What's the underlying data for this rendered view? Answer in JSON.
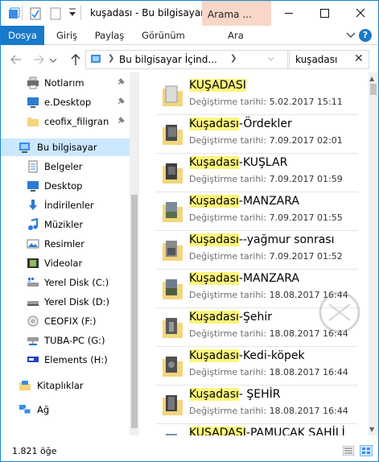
{
  "window": {
    "title": "kuşadası - Bu bilgisayar İ...",
    "context_tab": "Arama ..."
  },
  "ribbon": {
    "tabs": [
      "Dosya",
      "Giriş",
      "Paylaş",
      "Görünüm",
      "Ara"
    ]
  },
  "address": {
    "crumb": "Bu bilgisayar İçind...",
    "search_value": "kuşadası"
  },
  "nav": {
    "items": [
      {
        "label": "Notlarım",
        "icon": "printer-icon",
        "pinned": true
      },
      {
        "label": "e.Desktop",
        "icon": "desktop-icon",
        "pinned": true
      },
      {
        "label": "ceofix_filigran",
        "icon": "folder-icon",
        "pinned": true
      },
      {
        "label": "Bu bilgisayar",
        "icon": "computer-icon",
        "selected": true
      },
      {
        "label": "Belgeler",
        "icon": "documents-icon"
      },
      {
        "label": "Desktop",
        "icon": "desktop-icon"
      },
      {
        "label": "İndirilenler",
        "icon": "downloads-icon"
      },
      {
        "label": "Müzikler",
        "icon": "music-icon"
      },
      {
        "label": "Resimler",
        "icon": "pictures-icon"
      },
      {
        "label": "Videolar",
        "icon": "videos-icon"
      },
      {
        "label": "Yerel Disk (C:)",
        "icon": "windows-drive-icon"
      },
      {
        "label": "Yerel Disk (D:)",
        "icon": "drive-icon"
      },
      {
        "label": "CEOFIX (F:)",
        "icon": "optical-drive-icon"
      },
      {
        "label": "TUBA-PC (G:)",
        "icon": "network-drive-icon"
      },
      {
        "label": "Elements (H:)",
        "icon": "usb-drive-icon"
      },
      {
        "label": "Kitaplıklar",
        "icon": "libraries-icon"
      },
      {
        "label": "Ağ",
        "icon": "network-icon"
      }
    ]
  },
  "files": {
    "date_label": "Değiştirme tarihi:",
    "items": [
      {
        "hl": "KUŞADASI",
        "rest": "",
        "date": "5.02.2017 15:11"
      },
      {
        "hl": "Kuşadası",
        "rest": "-Ördekler",
        "date": "7.09.2017 02:01"
      },
      {
        "hl": "Kuşadası",
        "rest": "-KUŞLAR",
        "date": "7.09.2017 01:59"
      },
      {
        "hl": "Kuşadası",
        "rest": "-MANZARA",
        "date": "7.09.2017 01:55"
      },
      {
        "hl": "Kuşadası",
        "rest": "--yağmur sonrası",
        "date": "7.09.2017 01:52"
      },
      {
        "hl": "Kuşadası",
        "rest": "-MANZARA",
        "date": "18.08.2017 16:44"
      },
      {
        "hl": "Kuşadası",
        "rest": "-Şehir",
        "date": "18.08.2017 16:44"
      },
      {
        "hl": "Kuşadası",
        "rest": "-Kedi-köpek",
        "date": "18.08.2017 16:44"
      },
      {
        "hl": "Kuşadası",
        "rest": "- ŞEHİR",
        "date": "18.08.2017 16:44"
      },
      {
        "hl": "KUSADASI",
        "rest": "-PAMUCAK SAHİLİ",
        "date": ""
      }
    ]
  },
  "status": {
    "count": "1.821 öğe"
  },
  "colors": {
    "accent": "#1979ca",
    "highlight": "#fdf67c",
    "selection": "#cce8ff",
    "context_tab": "#f9d7c8"
  }
}
